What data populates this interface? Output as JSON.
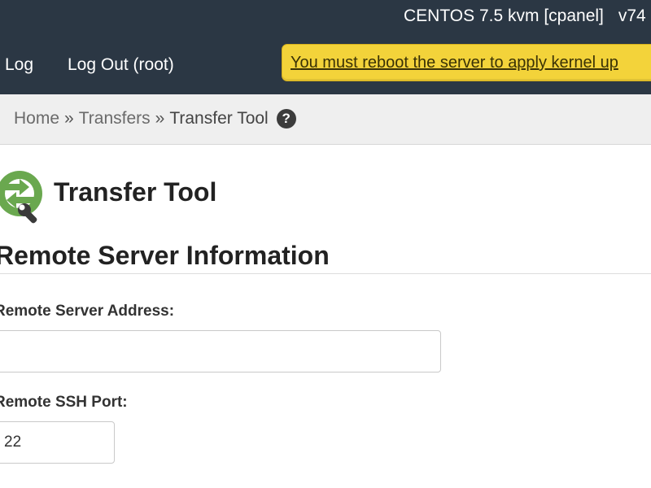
{
  "header": {
    "server_name": "CENTOS 7.5 kvm [cpanel]",
    "version": "v74",
    "nav": {
      "log_label": "Log",
      "logout_label": "Log Out (root)"
    },
    "reboot_notice": "You must reboot the server to apply kernel up"
  },
  "breadcrumb": {
    "home": "Home",
    "separator": "»",
    "transfers": "Transfers",
    "current": "Transfer Tool",
    "help_icon": "question-circle-icon"
  },
  "page": {
    "icon": "transfer-tool-icon",
    "title": "Transfer Tool",
    "section_title": "Remote Server Information"
  },
  "form": {
    "address_label": "Remote Server Address:",
    "address_value": "",
    "port_label": "Remote SSH Port:",
    "port_value": "22"
  },
  "colors": {
    "header_bg": "#2b3744",
    "notice_bg": "#f3d33a",
    "breadcrumb_bg": "#efefef",
    "icon_green": "#6aa84f",
    "icon_dark": "#3a3a3a"
  }
}
